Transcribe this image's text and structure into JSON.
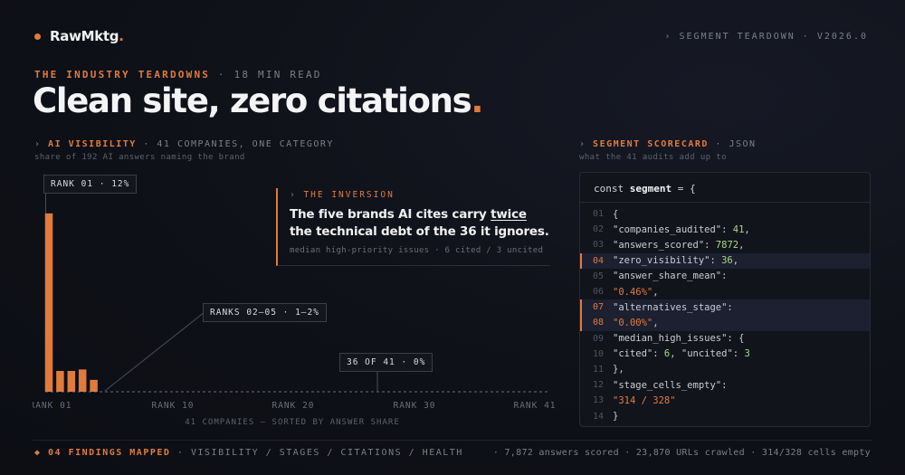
{
  "brand": {
    "name": "RawMktg",
    "dot": "."
  },
  "header": {
    "crumb": "› SEGMENT TEARDOWN · V2026.0"
  },
  "kicker": {
    "section": "THE INDUSTRY TEARDOWNS",
    "meta": " · 18 MIN READ"
  },
  "hero": {
    "title": "Clean site, zero citations",
    "dot": "."
  },
  "left_panel": {
    "label_prefix": "› ",
    "label_accent": "AI VISIBILITY",
    "label_rest": " · 41 COMPANIES, ONE CATEGORY",
    "subtitle": "share of 192 AI answers naming the brand",
    "x_ticks": [
      "RANK 01",
      "RANK 10",
      "RANK 20",
      "RANK 30",
      "RANK 41"
    ],
    "caption": "41 COMPANIES — SORTED BY ANSWER SHARE",
    "callouts": {
      "top": "RANK 01 · 12%",
      "mid": "RANKS 02–05 · 1–2%",
      "zero": "36 OF 41 · 0%"
    }
  },
  "inversion": {
    "kicker_prefix": "› ",
    "kicker": "THE INVERSION",
    "text_before": "The five brands AI cites carry ",
    "text_emph": "twice",
    "text_after": " the technical debt of the 36 it ignores.",
    "note": "median high-priority issues · 6 cited / 3 uncited"
  },
  "right_panel": {
    "label_prefix": "› ",
    "label_accent": "SEGMENT SCORECARD",
    "label_rest": " · JSON",
    "subtitle": "what the 41 audits add up to",
    "code_head_pre": "const ",
    "code_head_var": "segment",
    "code_head_post": " = {",
    "lines": [
      {
        "no": "01",
        "text": "{"
      },
      {
        "no": "02",
        "key": "\"companies_audited\": ",
        "num": "41",
        "tail": ","
      },
      {
        "no": "03",
        "key": "\"answers_scored\": ",
        "num": "7872",
        "tail": ","
      },
      {
        "no": "04",
        "key": "\"zero_visibility\": ",
        "num": "36",
        "tail": ","
      },
      {
        "no": "05",
        "text": "\"answer_share_mean\":"
      },
      {
        "no": "06",
        "str": "\"0.46%\"",
        "tail": ","
      },
      {
        "no": "07",
        "text": "\"alternatives_stage\":"
      },
      {
        "no": "08",
        "str": "\"0.00%\"",
        "tail": ","
      },
      {
        "no": "09",
        "text": "\"median_high_issues\": {"
      },
      {
        "no": "10",
        "key": "\"cited\": ",
        "num": "6",
        "tail": ", ",
        "key2": "\"uncited\": ",
        "num2": "3"
      },
      {
        "no": "11",
        "text": "},"
      },
      {
        "no": "12",
        "text": "\"stage_cells_empty\":"
      },
      {
        "no": "13",
        "str": "\"314 / 328\""
      },
      {
        "no": "14",
        "text": "}"
      }
    ],
    "highlighted": [
      "04",
      "07",
      "08"
    ]
  },
  "footer": {
    "left_accent": "◆ 04 FINDINGS MAPPED",
    "left_rest": " · VISIBILITY / STAGES / CITATIONS / HEALTH",
    "right": "· 7,872 answers scored · 23,870 URLs crawled · 314/328 cells empty"
  },
  "colors": {
    "accent": "#e07b3c",
    "background": "#0f1118",
    "number": "#a9d987",
    "string": "#e07b3c"
  },
  "chart_data": {
    "type": "bar",
    "x": [
      1,
      2,
      3,
      4,
      5,
      6,
      7,
      8,
      9,
      10,
      11,
      12,
      13,
      14,
      15,
      16,
      17,
      18,
      19,
      20,
      21,
      22,
      23,
      24,
      25,
      26,
      27,
      28,
      29,
      30,
      31,
      32,
      33,
      34,
      35,
      36,
      37,
      38,
      39,
      40,
      41
    ],
    "values": [
      12,
      1.4,
      1.4,
      1.5,
      0.8,
      0,
      0,
      0,
      0,
      0,
      0,
      0,
      0,
      0,
      0,
      0,
      0,
      0,
      0,
      0,
      0,
      0,
      0,
      0,
      0,
      0,
      0,
      0,
      0,
      0,
      0,
      0,
      0,
      0,
      0,
      0,
      0,
      0,
      0,
      0,
      0
    ],
    "xlabel": "41 COMPANIES — SORTED BY ANSWER SHARE",
    "ylabel": "",
    "ylim": [
      0,
      14
    ],
    "grid": false
  }
}
